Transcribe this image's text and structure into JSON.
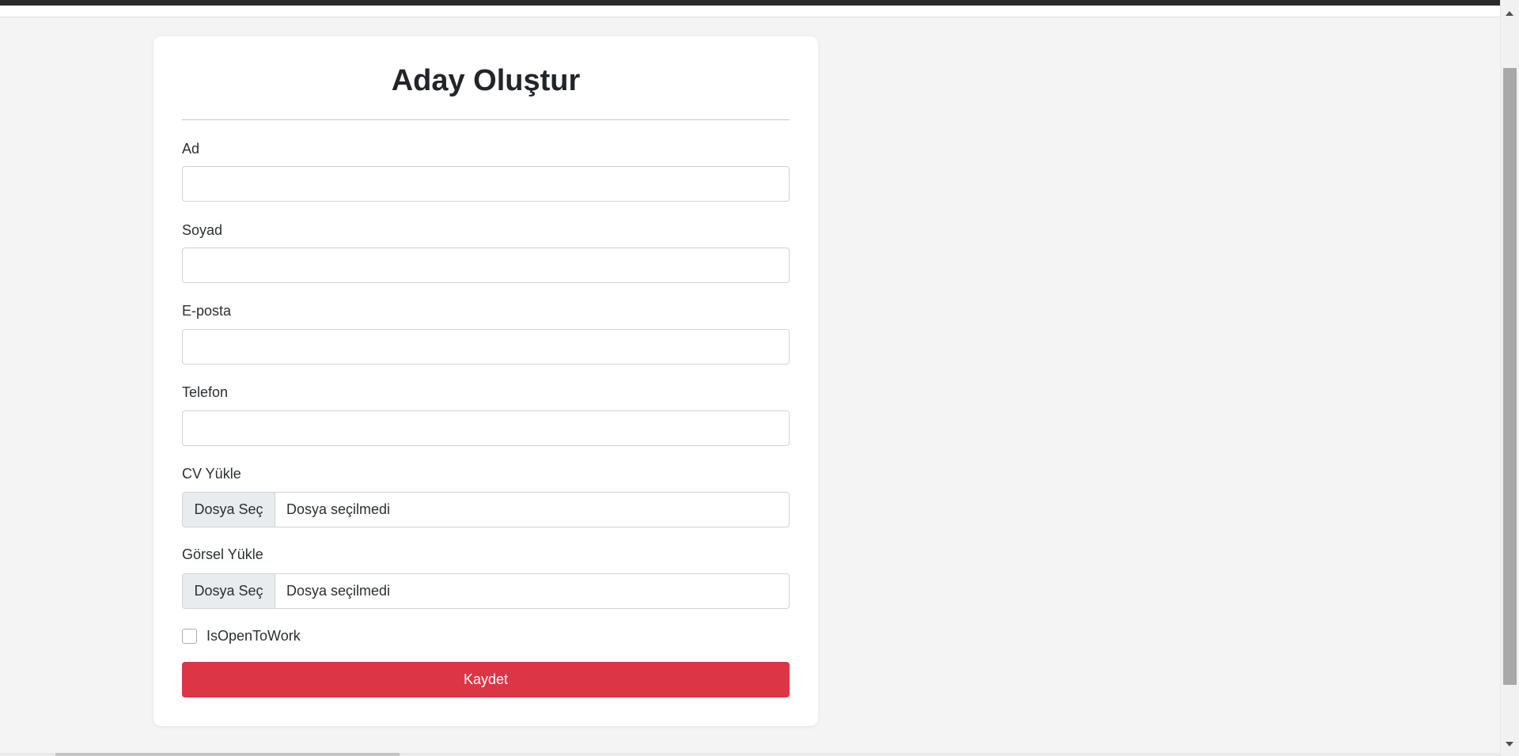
{
  "form": {
    "title": "Aday Oluştur",
    "fields": {
      "first_name": {
        "label": "Ad",
        "value": ""
      },
      "last_name": {
        "label": "Soyad",
        "value": ""
      },
      "email": {
        "label": "E-posta",
        "value": ""
      },
      "phone": {
        "label": "Telefon",
        "value": ""
      }
    },
    "cv_upload": {
      "label": "CV Yükle",
      "button_label": "Dosya Seç",
      "status": "Dosya seçilmedi"
    },
    "image_upload": {
      "label": "Görsel Yükle",
      "button_label": "Dosya Seç",
      "status": "Dosya seçilmedi"
    },
    "open_to_work": {
      "label": "IsOpenToWork",
      "checked": false
    },
    "submit_label": "Kaydet"
  },
  "colors": {
    "background": "#f4f4f4",
    "card": "#ffffff",
    "submit_button": "#dc3545",
    "file_button": "#e9ecef",
    "input_border": "#ced4da"
  }
}
